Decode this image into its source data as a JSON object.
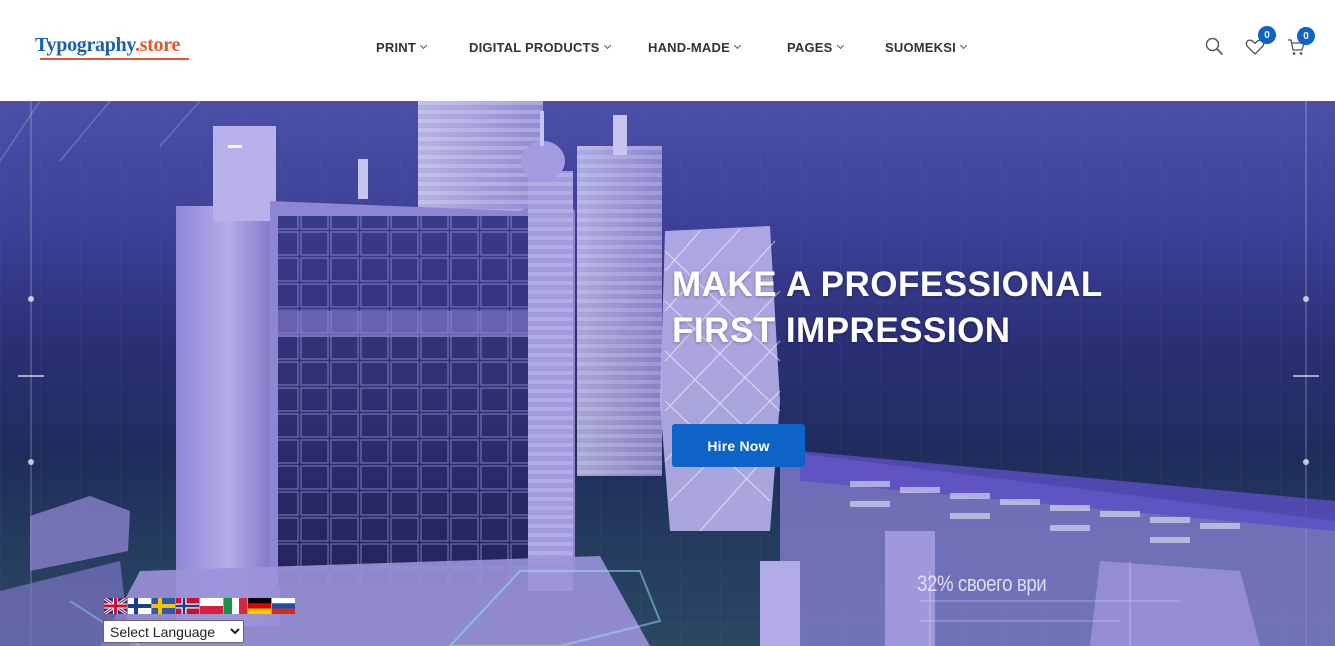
{
  "header": {
    "logo_part1": "Typography",
    "logo_part2": ".store",
    "nav": [
      {
        "label": "PRINT"
      },
      {
        "label": "DIGITAL PRODUCTS"
      },
      {
        "label": "HAND-MADE"
      },
      {
        "label": "PAGES"
      },
      {
        "label": "SUOMEKSI"
      }
    ],
    "wishlist_count": "0",
    "cart_count": "0",
    "icons": [
      "search-icon",
      "heart-icon",
      "cart-icon"
    ]
  },
  "hero": {
    "headline_line1": "MAKE A PROFESSIONAL",
    "headline_line2": "FIRST IMPRESSION",
    "cta_label": "Hire Now",
    "video_caption": "32% своего ври"
  },
  "language": {
    "flags": [
      "en",
      "fi",
      "sv",
      "no",
      "pl",
      "it",
      "de",
      "ru"
    ],
    "select_value": "Select Language"
  },
  "colors": {
    "accent": "#0d63c8",
    "logo_blue": "#1a5fb4",
    "logo_orange": "#e8552a"
  }
}
